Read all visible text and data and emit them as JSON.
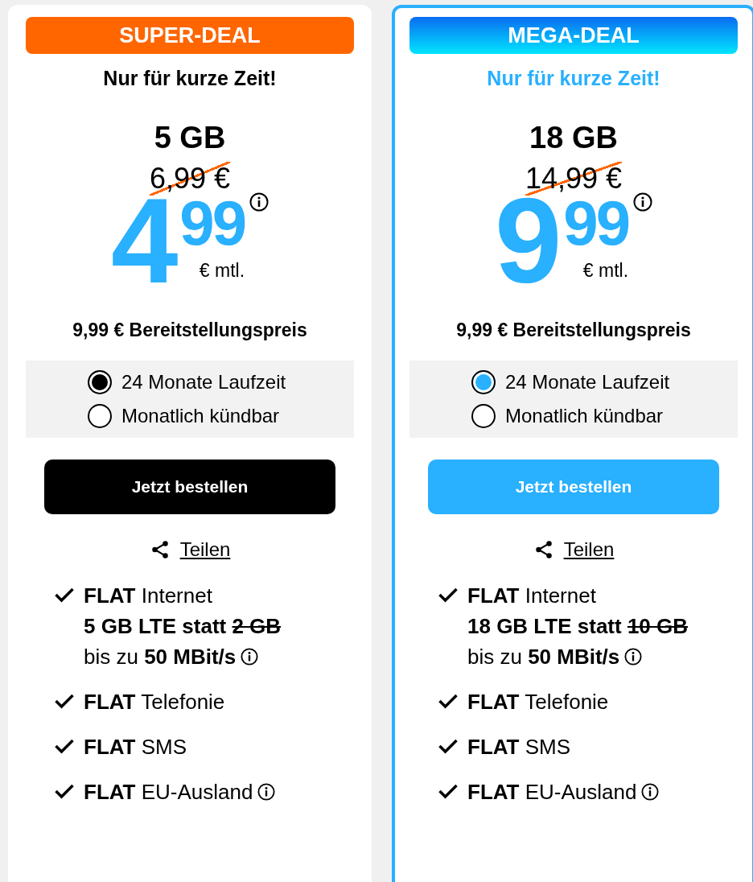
{
  "plans": [
    {
      "badge": "SUPER-DEAL",
      "highlighted": false,
      "tagline": "Nur für kurze Zeit!",
      "data": "5 GB",
      "old_price": "6,99 €",
      "price_main": "4",
      "price_cents": "99",
      "price_unit": "€ mtl.",
      "setup_fee": "9,99 € Bereitstellungspreis",
      "options": [
        {
          "label": "24 Monate Laufzeit",
          "selected": true
        },
        {
          "label": "Monatlich kündbar",
          "selected": false
        }
      ],
      "order_button": "Jetzt bestellen",
      "share": "Teilen",
      "features": [
        {
          "bold": "FLAT",
          "text": "Internet",
          "detail_bold": "5 GB LTE statt",
          "detail_struck": "2 GB",
          "speed_text": "bis zu",
          "speed_bold": "50 MBit/s",
          "info": true
        },
        {
          "bold": "FLAT",
          "text": "Telefonie",
          "info": false
        },
        {
          "bold": "FLAT",
          "text": "SMS",
          "info": false
        },
        {
          "bold": "FLAT",
          "text": "EU-Ausland",
          "info": true
        }
      ]
    },
    {
      "badge": "MEGA-DEAL",
      "highlighted": true,
      "tagline": "Nur für kurze Zeit!",
      "data": "18 GB",
      "old_price": "14,99 €",
      "price_main": "9",
      "price_cents": "99",
      "price_unit": "€ mtl.",
      "setup_fee": "9,99 € Bereitstellungspreis",
      "options": [
        {
          "label": "24 Monate Laufzeit",
          "selected": true
        },
        {
          "label": "Monatlich kündbar",
          "selected": false
        }
      ],
      "order_button": "Jetzt bestellen",
      "share": "Teilen",
      "features": [
        {
          "bold": "FLAT",
          "text": "Internet",
          "detail_bold": "18 GB LTE statt",
          "detail_struck": "10 GB",
          "speed_text": "bis zu",
          "speed_bold": "50 MBit/s",
          "info": true
        },
        {
          "bold": "FLAT",
          "text": "Telefonie",
          "info": false
        },
        {
          "bold": "FLAT",
          "text": "SMS",
          "info": false
        },
        {
          "bold": "FLAT",
          "text": "EU-Ausland",
          "info": true
        }
      ]
    }
  ]
}
